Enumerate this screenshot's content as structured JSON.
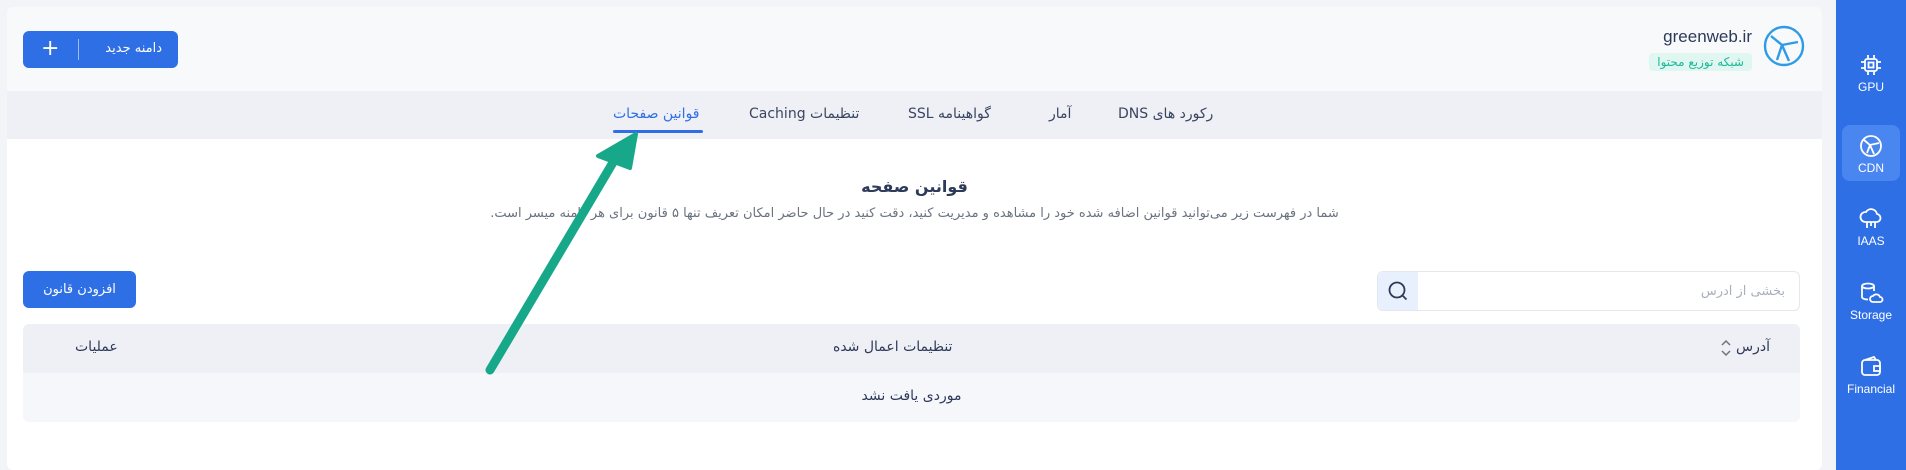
{
  "sidebar": {
    "items": [
      {
        "label": "GPU",
        "icon": "chip-icon",
        "active": false
      },
      {
        "label": "CDN",
        "icon": "globe-icon",
        "active": true
      },
      {
        "label": "IAAS",
        "icon": "cloud-server-icon",
        "active": false
      },
      {
        "label": "Storage",
        "icon": "database-cloud-icon",
        "active": false
      },
      {
        "label": "Financial",
        "icon": "wallet-icon",
        "active": false
      }
    ]
  },
  "header": {
    "domain": "greenweb.ir",
    "badge": "شبکه توزیع محتوا",
    "new_domain_label": "دامنه جدید",
    "new_domain_icon": "plus-icon"
  },
  "tabs": [
    {
      "label": "رکورد های DNS",
      "active": false
    },
    {
      "label": "آمار",
      "active": false
    },
    {
      "label": "گواهینامه SSL",
      "active": false
    },
    {
      "label": "تنظیمات Caching",
      "active": false
    },
    {
      "label": "قوانین صفحات",
      "active": true
    }
  ],
  "section": {
    "title": "قوانین صفحه",
    "description": "شما در فهرست زیر می‌توانید قوانین اضافه شده خود را مشاهده و مدیریت کنید، دقت کنید در حال حاضر امکان تعریف تنها ۵ قانون برای هر دامنه میسر است."
  },
  "toolbar": {
    "add_rule_label": "افزودن قانون",
    "search_placeholder": "بخشی از آدرس"
  },
  "table": {
    "columns": [
      "آدرس",
      "تنظیمات اعمال شده",
      "عملیات"
    ],
    "empty_message": "موردی یافت نشد"
  },
  "colors": {
    "primary": "#2f6fe6",
    "accent_teal": "#1fb89a",
    "annotation_arrow": "#17a88a"
  }
}
